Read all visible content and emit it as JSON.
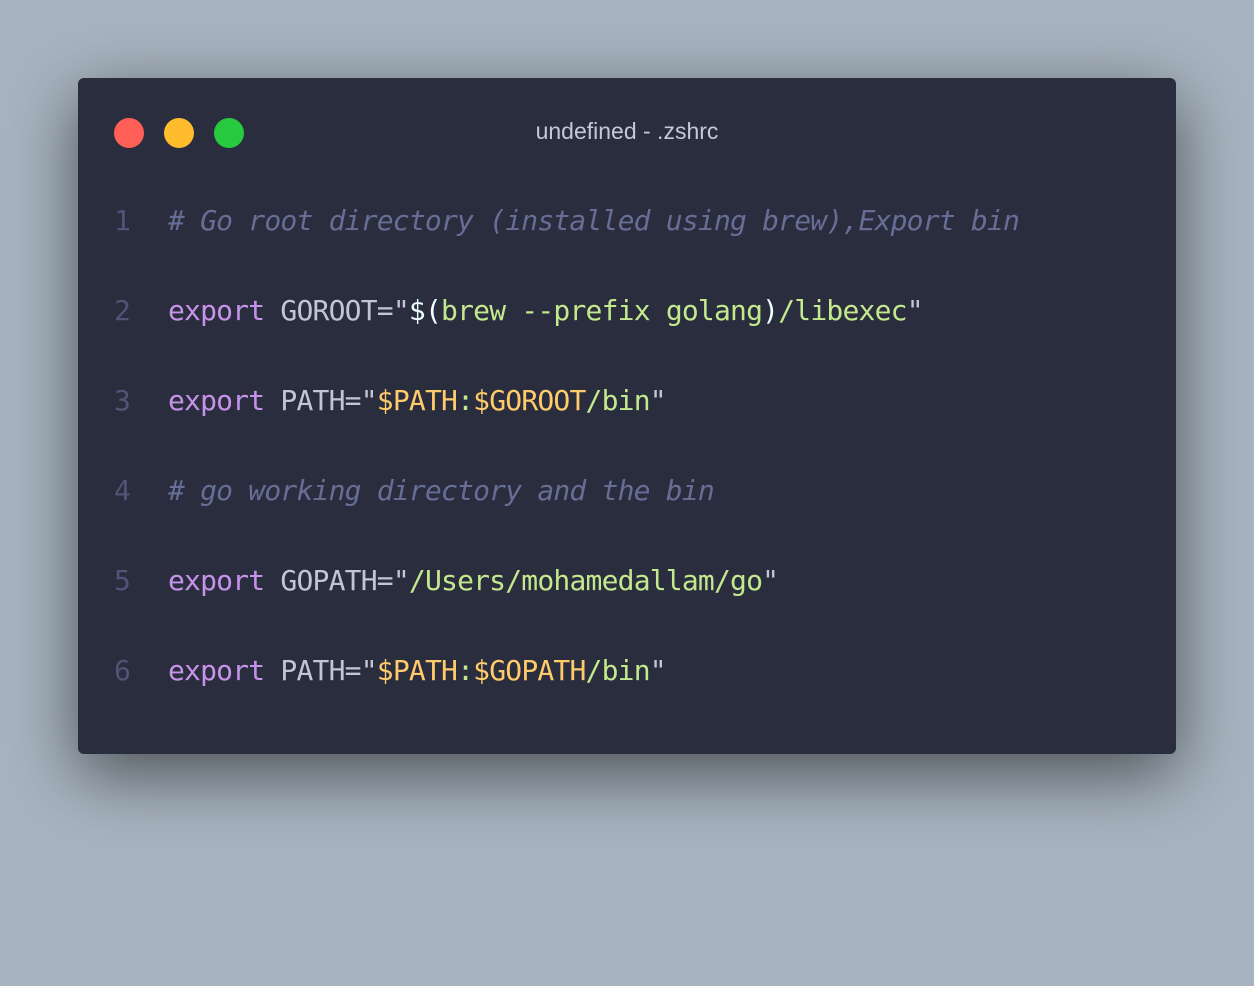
{
  "window": {
    "title": "undefined - .zshrc"
  },
  "colors": {
    "background": "#a7b3bf",
    "editor_bg": "#292d3e",
    "close": "#ff5f56",
    "minimize": "#ffbd2e",
    "maximize": "#27c93f",
    "keyword": "#c792ea",
    "string": "#c3e88d",
    "variable": "#ffcb6b",
    "comment": "#676e95"
  },
  "code": {
    "lines": [
      {
        "number": "1",
        "comment": "# Go root directory (installed using brew),Export bin"
      },
      {
        "number": "2",
        "keyword": "export",
        "name": " GOROOT=",
        "quote_open": "\"",
        "subst_open": "$(",
        "string": "brew --prefix golang",
        "subst_close": ")",
        "tail": "/libexec",
        "quote_close": "\""
      },
      {
        "number": "3",
        "keyword": "export",
        "name": " PATH=",
        "quote_open": "\"",
        "var1": "$PATH",
        "sep": ":",
        "var2": "$GOROOT",
        "tail": "/bin",
        "quote_close": "\""
      },
      {
        "number": "4",
        "comment": "# go working directory and the bin"
      },
      {
        "number": "5",
        "keyword": "export",
        "name": " GOPATH=",
        "quote_open": "\"",
        "string": "/Users/mohamedallam/go",
        "quote_close": "\""
      },
      {
        "number": "6",
        "keyword": "export",
        "name": " PATH=",
        "quote_open": "\"",
        "var1": "$PATH",
        "sep": ":",
        "var2": "$GOPATH",
        "tail": "/bin",
        "quote_close": "\""
      }
    ]
  }
}
